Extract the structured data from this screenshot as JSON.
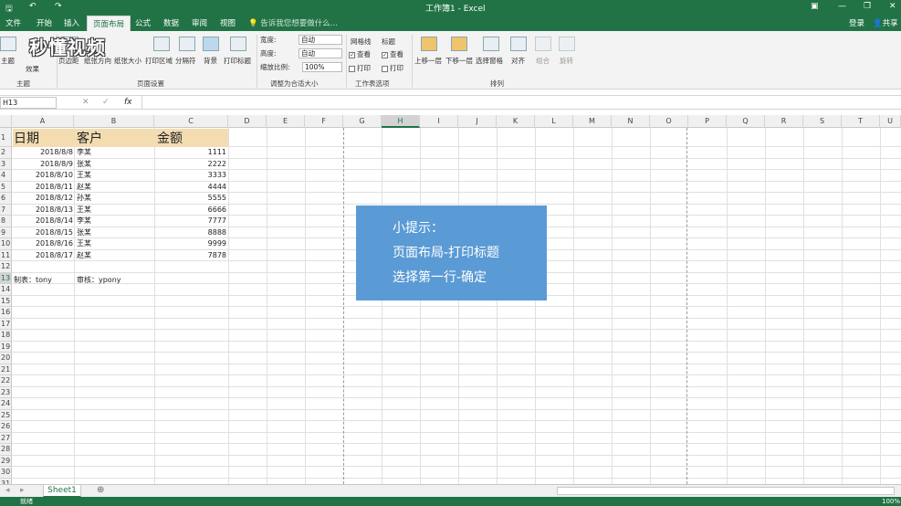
{
  "titlebar": {
    "title": "工作簿1 - Excel",
    "login": "登录",
    "share": "共享"
  },
  "tabs": [
    "文件",
    "开始",
    "插入",
    "页面布局",
    "公式",
    "数据",
    "审阅",
    "视图"
  ],
  "tell_me": "告诉我您想要做什么...",
  "ribbon": {
    "themes_group": "主题",
    "theme_btn": "主题",
    "effects_btn": "效果",
    "page_setup_group": "页面设置",
    "margins": "页边距",
    "orientation": "纸张方向",
    "size": "纸张大小",
    "print_area": "打印区域",
    "breaks": "分隔符",
    "background": "背景",
    "print_titles": "打印标题",
    "scale_group": "调整为合适大小",
    "width_label": "宽度:",
    "width_value": "自动",
    "height_label": "高度:",
    "height_value": "自动",
    "scale_label": "缩放比例:",
    "scale_value": "100%",
    "sheet_options_group": "工作表选项",
    "gridlines": "网格线",
    "headings": "标题",
    "view1": "查看",
    "print1": "打印",
    "view2": "查看",
    "print2": "打印",
    "arrange_group": "排列",
    "bring_forward": "上移一层",
    "send_backward": "下移一层",
    "selection_pane": "选择窗格",
    "align": "对齐",
    "group": "组合",
    "rotate": "旋转"
  },
  "formula_bar": {
    "name_box": "H13",
    "fx": "fx",
    "value": ""
  },
  "columns": [
    "A",
    "B",
    "C",
    "D",
    "E",
    "F",
    "G",
    "H",
    "I",
    "J",
    "K",
    "L",
    "M",
    "N",
    "O",
    "P",
    "Q",
    "R",
    "S",
    "T",
    "U"
  ],
  "rows": [
    "1",
    "2",
    "3",
    "4",
    "5",
    "6",
    "7",
    "8",
    "9",
    "10",
    "11",
    "12",
    "13",
    "14",
    "15",
    "16",
    "17",
    "18",
    "19",
    "20",
    "21",
    "22",
    "23",
    "24",
    "25",
    "26",
    "27",
    "28",
    "29",
    "30",
    "31"
  ],
  "selected_cell": "H13",
  "table": {
    "headers": [
      "日期",
      "客户",
      "金额"
    ],
    "records": [
      [
        "2018/8/8",
        "李某",
        "1111"
      ],
      [
        "2018/8/9",
        "张某",
        "2222"
      ],
      [
        "2018/8/10",
        "王某",
        "3333"
      ],
      [
        "2018/8/11",
        "赵某",
        "4444"
      ],
      [
        "2018/8/12",
        "孙某",
        "5555"
      ],
      [
        "2018/8/13",
        "王某",
        "6666"
      ],
      [
        "2018/8/14",
        "李某",
        "7777"
      ],
      [
        "2018/8/15",
        "张某",
        "8888"
      ],
      [
        "2018/8/16",
        "王某",
        "9999"
      ],
      [
        "2018/8/17",
        "赵某",
        "7878"
      ]
    ],
    "maker": "制表：tony",
    "reviewer": "审核：ypony"
  },
  "tip": {
    "line1": "小提示：",
    "line2": "页面布局-打印标题",
    "line3": "选择第一行-确定"
  },
  "sheet_tab": "Sheet1",
  "status": {
    "ready": "就绪",
    "zoom": "100%"
  },
  "watermark": "秒懂视频",
  "colors": {
    "excel_green": "#217346",
    "tip_blue": "#5b9bd5",
    "header_fill": "#f2dcb0"
  }
}
